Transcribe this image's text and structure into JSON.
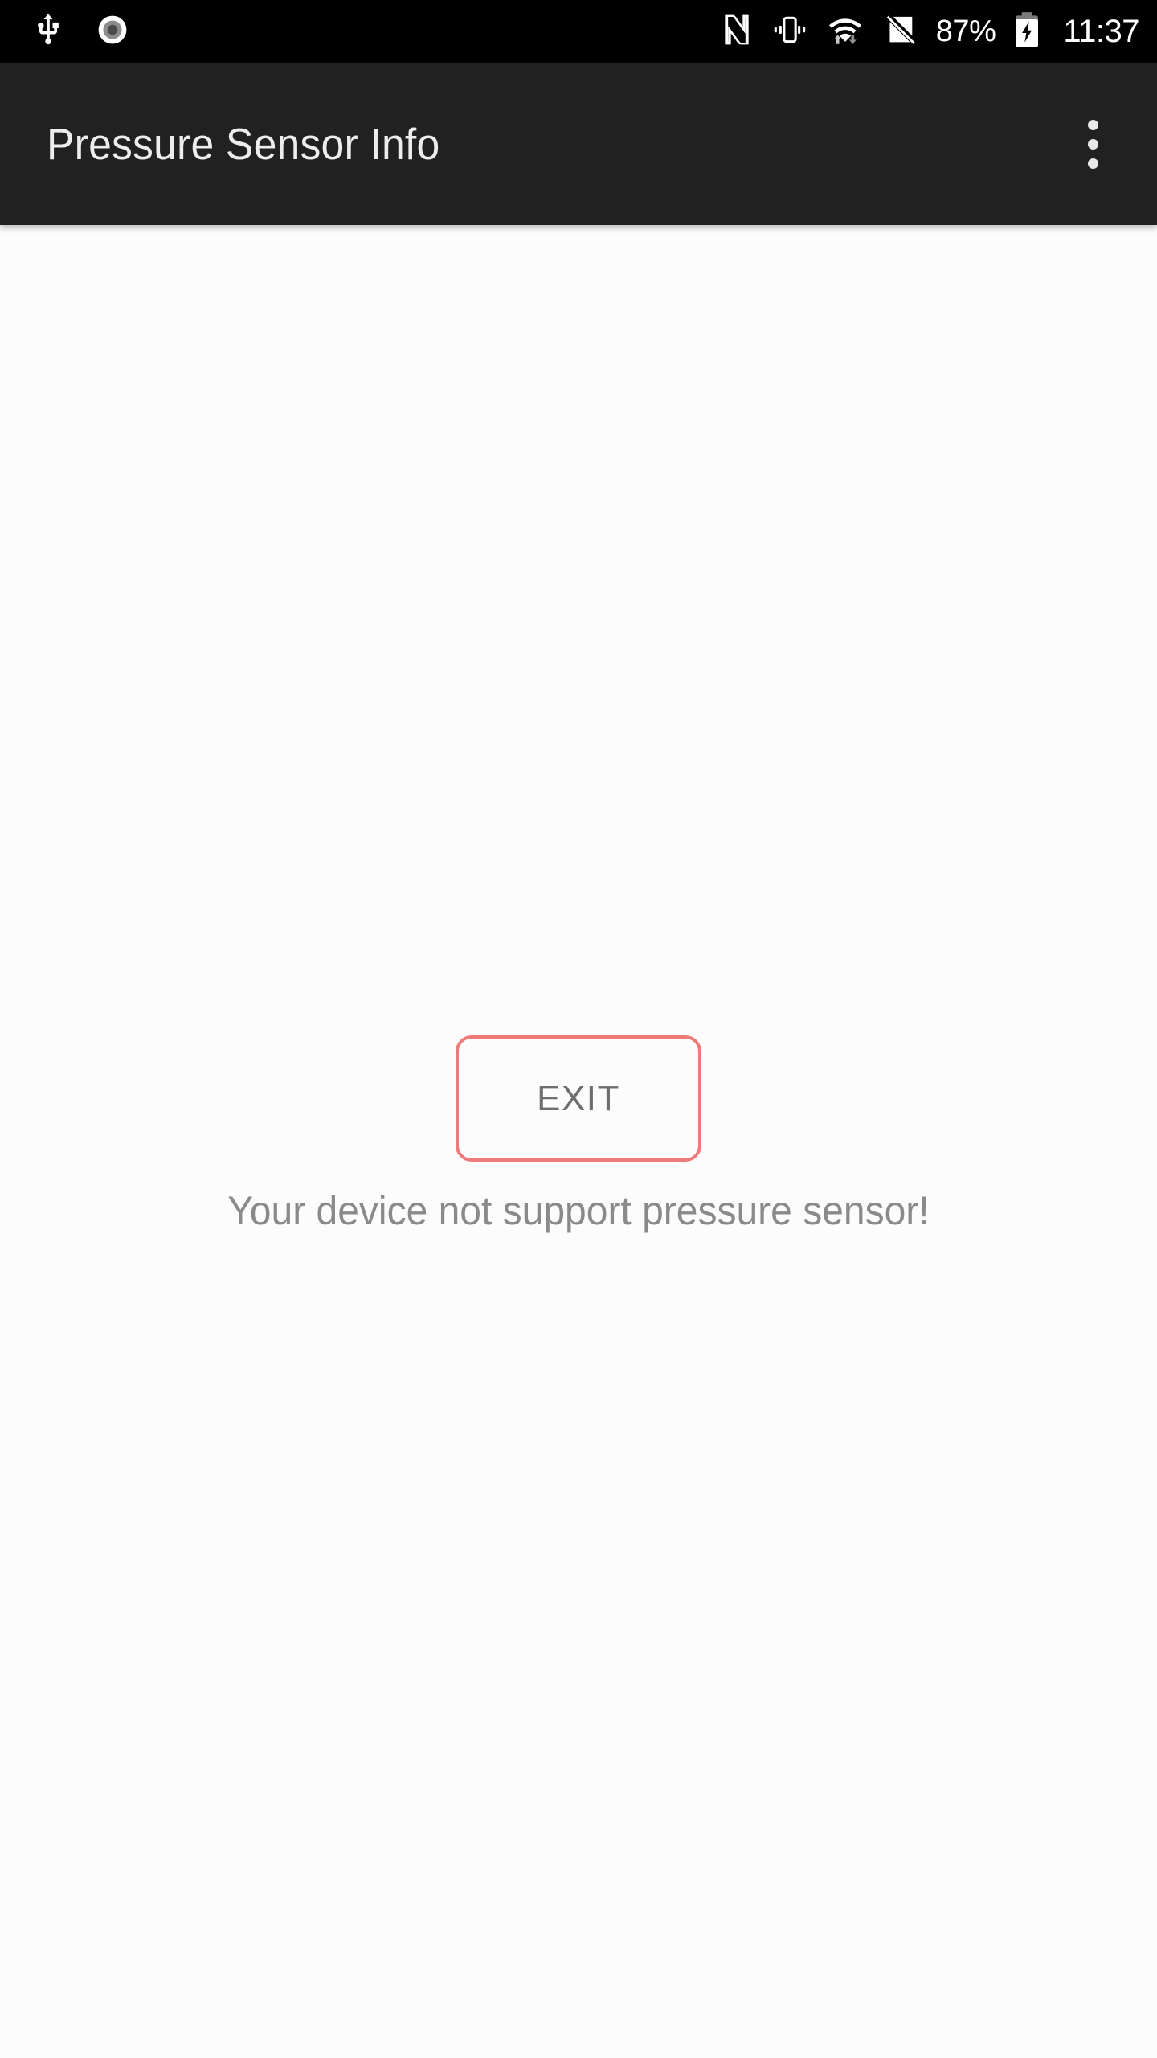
{
  "status_bar": {
    "background": "#000000",
    "left_icons": [
      {
        "name": "usb-icon",
        "label": "USB connected"
      },
      {
        "name": "screen-record-icon",
        "label": "Screen recording"
      }
    ],
    "right_icons": [
      {
        "name": "nfc-icon",
        "label": "NFC enabled"
      },
      {
        "name": "vibrate-icon",
        "label": "Ringer vibrate"
      },
      {
        "name": "wifi-icon",
        "label": "Wi-Fi connected with data activity"
      },
      {
        "name": "no-sim-icon",
        "label": "No SIM card"
      }
    ],
    "battery_percent": "87%",
    "battery_icon": "battery-charging-icon",
    "clock": "11:37"
  },
  "app_bar": {
    "title": "Pressure Sensor Info",
    "background": "#212121",
    "title_color": "#EDEDED",
    "overflow_icon": "overflow-menu-icon"
  },
  "main": {
    "background": "#FCFCFC",
    "exit_button": {
      "label": "EXIT",
      "border_color": "#EE7A7A",
      "text_color": "#6E6E6E"
    },
    "message": "Your device not support pressure sensor!",
    "message_color": "#8A8A8A"
  }
}
